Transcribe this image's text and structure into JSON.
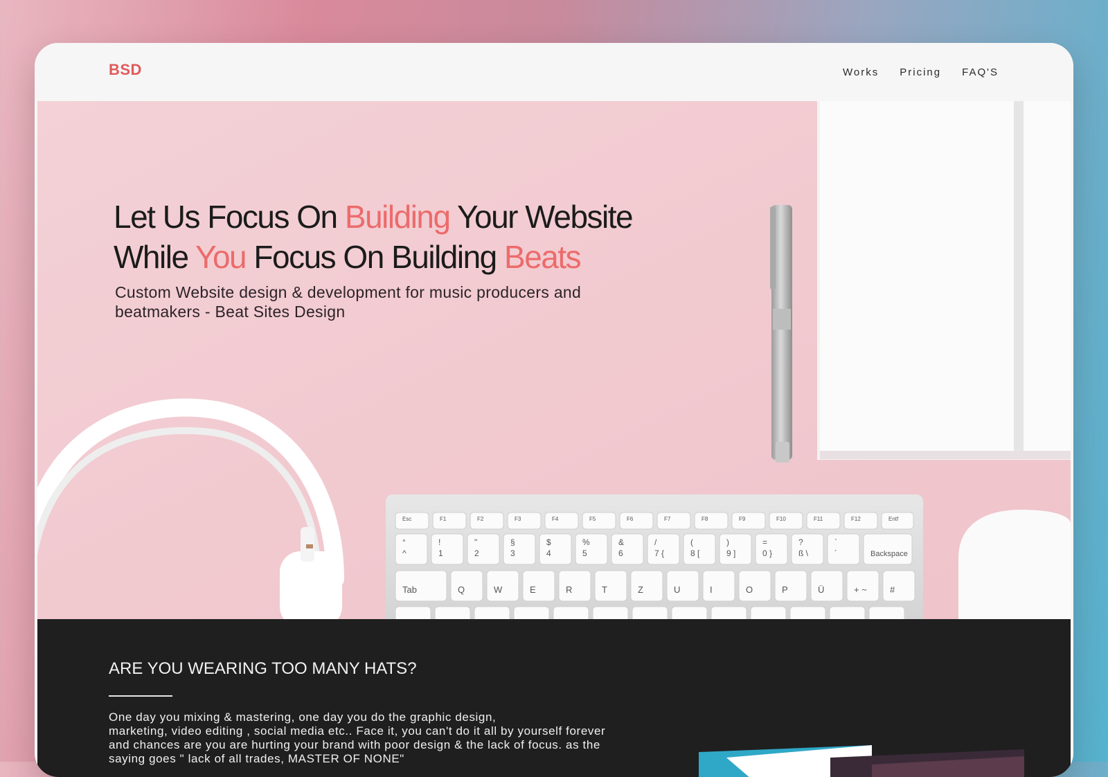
{
  "nav": {
    "logo": "BSD",
    "links": [
      "Works",
      "Pricing",
      "FAQ'S"
    ]
  },
  "hero": {
    "title_line1": [
      "Let Us Focus On ",
      "Building",
      " Your Website"
    ],
    "title_line2": [
      "While ",
      "You",
      " Focus On Building ",
      "Beats"
    ],
    "subtitle": "Custom Website design & development for music producers and beatmakers - Beat Sites Design"
  },
  "section": {
    "title": "ARE YOU WEARING TOO MANY HATS?",
    "body": "One day you mixing & mastering, one day you do the graphic design,\nmarketing, video editing , social media etc.. Face it, you can't do it all by yourself forever\n and chances are you are hurting your brand with poor design & the lack of focus. as the\nsaying goes \" lack of all trades, MASTER OF NONE\""
  },
  "colors": {
    "accent": "#ec6b6b",
    "logo": "#e05a5a",
    "hero_bg": "#f2cdd3",
    "dark_bg": "#1f1f1f"
  },
  "keyboard": {
    "fn_row": [
      "Esc",
      "F1",
      "F2",
      "F3",
      "F4",
      "F5",
      "F6",
      "F7",
      "F8",
      "F9",
      "F10",
      "F11",
      "F12",
      "Entf"
    ],
    "num_row_bottom": [
      "^",
      "1",
      "2",
      "3",
      "4",
      "5",
      "6",
      "7 {",
      "8 [",
      "9 ]",
      "0 }",
      "ß \\",
      "´",
      "Backspace"
    ],
    "num_row_top": [
      "°",
      "!",
      "\"",
      "§",
      "$",
      "%",
      "&",
      "/",
      "(",
      ")",
      "=",
      "?",
      "`"
    ],
    "qwerty_row": [
      "Tab",
      "Q",
      "W",
      "E",
      "R",
      "T",
      "Z",
      "U",
      "I",
      "O",
      "P",
      "Ü",
      "+ ~",
      "#"
    ]
  }
}
